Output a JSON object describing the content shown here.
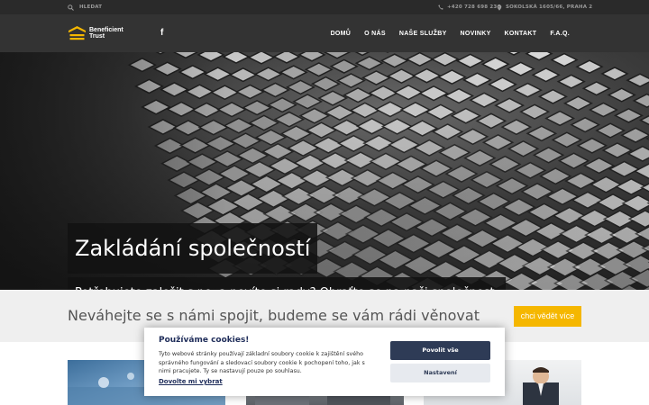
{
  "topbar": {
    "search_label": "HLEDAT",
    "phone": "+420 728 698 236",
    "address": "SOKOLSKÁ 1605/66, PRAHA 2"
  },
  "header": {
    "logo_line1": "Beneficient",
    "logo_line2": "Trust",
    "nav": [
      "DOMŮ",
      "O NÁS",
      "NAŠE SLUŽBY",
      "NOVINKY",
      "KONTAKT",
      "F.A.Q."
    ]
  },
  "hero": {
    "title": "Zakládání společností",
    "subtitle": "Potřebujete založit s.r.o. a nevíte si rady? Obraťte se na naši společnost."
  },
  "contact_strip": {
    "text": "Neváhejte se s námi spojit, budeme se vám rádi věnovat",
    "button": "chci vědět více"
  },
  "cookie": {
    "title": "Používáme cookies!",
    "text": "Tyto webové stránky používají základní soubory cookie k zajištění svého správného fungování a sledovací soubory cookie k pochopení toho, jak s nimi pracujete. Ty se nastavují pouze po souhlasu.",
    "link": "Dovolte mi vybrat",
    "allow": "Povolit vše",
    "settings": "Nastavení"
  },
  "colors": {
    "accent": "#f5b700",
    "dark": "#333333",
    "cookie_primary": "#2e3b56"
  },
  "icons": {
    "search": "search-icon",
    "phone": "phone-icon",
    "location": "map-pin-icon",
    "facebook": "facebook-icon"
  }
}
